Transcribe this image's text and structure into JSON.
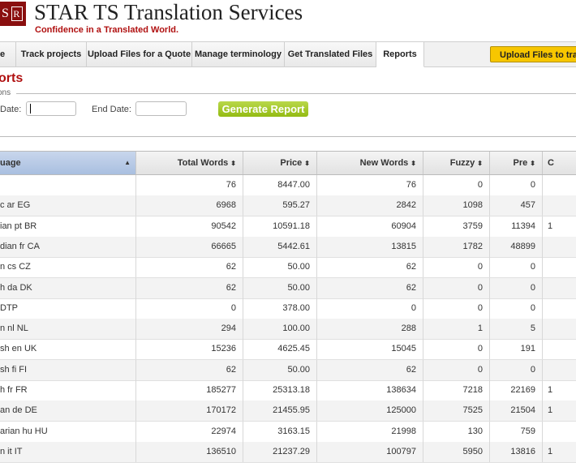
{
  "header": {
    "logo_text": "S",
    "logo_ar": "R",
    "brand": "STAR TS Translation Services",
    "tagline": "Confidence in a Translated World."
  },
  "nav": {
    "tabs": [
      {
        "label": "e"
      },
      {
        "label": "Track projects"
      },
      {
        "label": "Upload Files for a Quote"
      },
      {
        "label": "Manage terminology"
      },
      {
        "label": "Get Translated Files"
      },
      {
        "label": "Reports"
      }
    ],
    "upload_button": "Upload Files to transl"
  },
  "page": {
    "title": "orts",
    "legend": "ons"
  },
  "filters": {
    "start_label": "Date:",
    "end_label": "End Date:",
    "generate_button": "Generate Report"
  },
  "table": {
    "columns": [
      {
        "label": "uage",
        "sort": "▲"
      },
      {
        "label": "Total Words",
        "sort": "⬍"
      },
      {
        "label": "Price",
        "sort": "⬍"
      },
      {
        "label": "New Words",
        "sort": "⬍"
      },
      {
        "label": "Fuzzy",
        "sort": "⬍"
      },
      {
        "label": "Pre",
        "sort": "⬍"
      },
      {
        "label": "C",
        "sort": ""
      }
    ],
    "rows": [
      {
        "lang": "",
        "total": "76",
        "price": "8447.00",
        "new": "76",
        "fuzzy": "0",
        "pre": "0",
        "c": ""
      },
      {
        "lang": "c ar EG",
        "total": "6968",
        "price": "595.27",
        "new": "2842",
        "fuzzy": "1098",
        "pre": "457",
        "c": ""
      },
      {
        "lang": "ian pt BR",
        "total": "90542",
        "price": "10591.18",
        "new": "60904",
        "fuzzy": "3759",
        "pre": "11394",
        "c": "1"
      },
      {
        "lang": "dian fr CA",
        "total": "66665",
        "price": "5442.61",
        "new": "13815",
        "fuzzy": "1782",
        "pre": "48899",
        "c": ""
      },
      {
        "lang": "n cs CZ",
        "total": "62",
        "price": "50.00",
        "new": "62",
        "fuzzy": "0",
        "pre": "0",
        "c": ""
      },
      {
        "lang": "h da DK",
        "total": "62",
        "price": "50.00",
        "new": "62",
        "fuzzy": "0",
        "pre": "0",
        "c": ""
      },
      {
        "lang": "DTP",
        "total": "0",
        "price": "378.00",
        "new": "0",
        "fuzzy": "0",
        "pre": "0",
        "c": ""
      },
      {
        "lang": "n nl NL",
        "total": "294",
        "price": "100.00",
        "new": "288",
        "fuzzy": "1",
        "pre": "5",
        "c": ""
      },
      {
        "lang": "sh en UK",
        "total": "15236",
        "price": "4625.45",
        "new": "15045",
        "fuzzy": "0",
        "pre": "191",
        "c": ""
      },
      {
        "lang": "sh fi FI",
        "total": "62",
        "price": "50.00",
        "new": "62",
        "fuzzy": "0",
        "pre": "0",
        "c": ""
      },
      {
        "lang": "h fr FR",
        "total": "185277",
        "price": "25313.18",
        "new": "138634",
        "fuzzy": "7218",
        "pre": "22169",
        "c": "1"
      },
      {
        "lang": "an de DE",
        "total": "170172",
        "price": "21455.95",
        "new": "125000",
        "fuzzy": "7525",
        "pre": "21504",
        "c": "1"
      },
      {
        "lang": "arian hu HU",
        "total": "22974",
        "price": "3163.15",
        "new": "21998",
        "fuzzy": "130",
        "pre": "759",
        "c": ""
      },
      {
        "lang": "n it IT",
        "total": "136510",
        "price": "21237.29",
        "new": "100797",
        "fuzzy": "5950",
        "pre": "13816",
        "c": "1"
      }
    ]
  }
}
